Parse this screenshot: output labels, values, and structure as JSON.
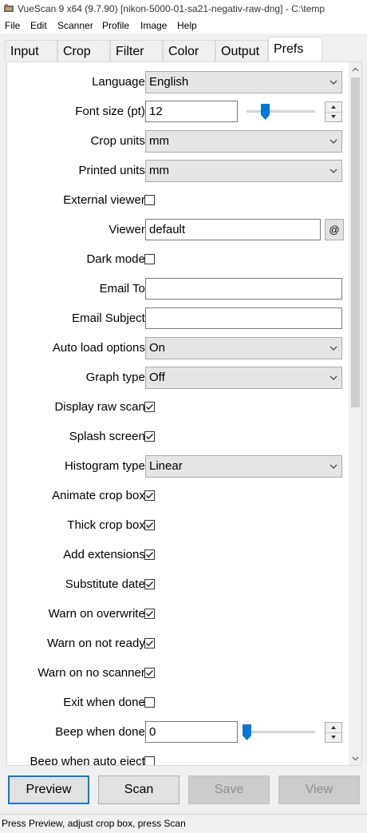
{
  "window": {
    "title": "VueScan 9 x64 (9.7.90) [nikon-5000-01-sa21-negativ-raw-dng] - C:\\temp"
  },
  "menu": [
    "File",
    "Edit",
    "Scanner",
    "Profile",
    "Image",
    "Help"
  ],
  "tabs": [
    {
      "label": "Input",
      "active": false
    },
    {
      "label": "Crop",
      "active": false
    },
    {
      "label": "Filter",
      "active": false
    },
    {
      "label": "Color",
      "active": false
    },
    {
      "label": "Output",
      "active": false
    },
    {
      "label": "Prefs",
      "active": true
    }
  ],
  "prefs": {
    "language": {
      "label": "Language:",
      "value": "English"
    },
    "font_size": {
      "label": "Font size (pt):",
      "value": "12",
      "slider_fraction": 0.27
    },
    "crop_units": {
      "label": "Crop units:",
      "value": "mm"
    },
    "printed_units": {
      "label": "Printed units:",
      "value": "mm"
    },
    "external_viewer": {
      "label": "External viewer:",
      "checked": false
    },
    "viewer": {
      "label": "Viewer:",
      "value": "default",
      "button": "@"
    },
    "dark_mode": {
      "label": "Dark mode:",
      "checked": false
    },
    "email_to": {
      "label": "Email To:",
      "value": ""
    },
    "email_subject": {
      "label": "Email Subject:",
      "value": ""
    },
    "auto_load_options": {
      "label": "Auto load options:",
      "value": "On"
    },
    "graph_type": {
      "label": "Graph type:",
      "value": "Off"
    },
    "display_raw_scan": {
      "label": "Display raw scan:",
      "checked": true
    },
    "splash_screen": {
      "label": "Splash screen:",
      "checked": true
    },
    "histogram_type": {
      "label": "Histogram type:",
      "value": "Linear"
    },
    "animate_crop_box": {
      "label": "Animate crop box:",
      "checked": true
    },
    "thick_crop_box": {
      "label": "Thick crop box:",
      "checked": true
    },
    "add_extensions": {
      "label": "Add extensions:",
      "checked": true
    },
    "substitute_date": {
      "label": "Substitute date:",
      "checked": true
    },
    "warn_on_overwrite": {
      "label": "Warn on overwrite:",
      "checked": true
    },
    "warn_on_not_ready": {
      "label": "Warn on not ready:",
      "checked": true
    },
    "warn_on_no_scanner": {
      "label": "Warn on no scanner:",
      "checked": true
    },
    "exit_when_done": {
      "label": "Exit when done:",
      "checked": false
    },
    "beep_when_done": {
      "label": "Beep when done:",
      "value": "0",
      "slider_fraction": 0.0
    },
    "beep_when_auto_eject": {
      "label": "Beep when auto eject:",
      "checked": false
    }
  },
  "buttons": {
    "preview": {
      "label": "Preview",
      "enabled": true
    },
    "scan": {
      "label": "Scan",
      "enabled": true
    },
    "save": {
      "label": "Save",
      "enabled": false
    },
    "view": {
      "label": "View",
      "enabled": false
    }
  },
  "status": "Press Preview, adjust crop box, press Scan",
  "colors": {
    "accent": "#0078d7",
    "disabled_text": "#8d8d8d"
  }
}
